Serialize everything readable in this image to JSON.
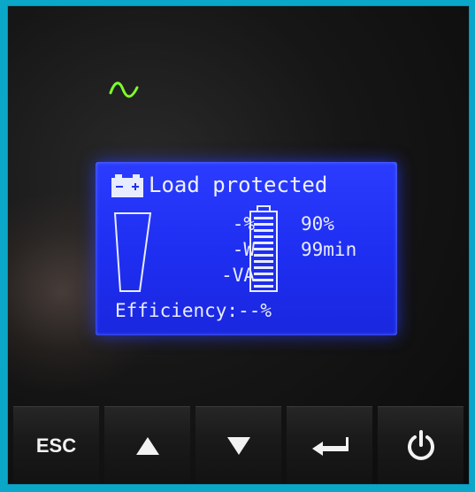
{
  "led": {
    "icon": "sine-wave-icon",
    "color": "#7dff2a"
  },
  "lcd": {
    "status_title": "Load protected",
    "load_percent": "-%",
    "load_watts": "-W",
    "load_va": "-VA",
    "battery_charge": "90%",
    "battery_runtime": "99min",
    "efficiency": "Efficiency:--%",
    "battery_bar_fill": 0.9,
    "colors": {
      "screen": "#2233ee",
      "text": "#e8ecff"
    }
  },
  "keys": {
    "esc_label": "ESC",
    "up_icon": "up-arrow-icon",
    "down_icon": "down-arrow-icon",
    "enter_icon": "enter-arrow-icon",
    "power_icon": "power-icon"
  }
}
